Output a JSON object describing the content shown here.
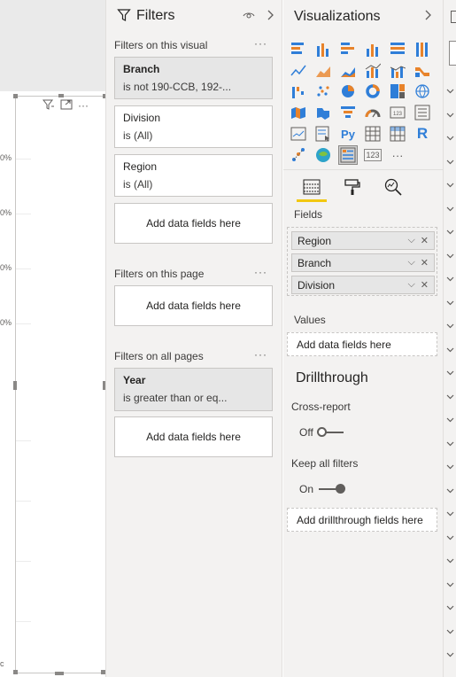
{
  "canvas": {
    "axis_labels": [
      "0%",
      "0%",
      "0%",
      "0%"
    ],
    "corner_label": "c"
  },
  "filters": {
    "title": "Filters",
    "sections": {
      "visual": "Filters on this visual",
      "page": "Filters on this page",
      "all": "Filters on all pages"
    },
    "more": "···",
    "visual_cards": [
      {
        "name": "Branch",
        "desc": "is not 190-CCB, 192-..."
      },
      {
        "name": "Division",
        "desc": "is (All)"
      },
      {
        "name": "Region",
        "desc": "is (All)"
      }
    ],
    "all_cards": [
      {
        "name": "Year",
        "desc": "is greater than or eq..."
      }
    ],
    "dropzone": "Add data fields here"
  },
  "viz": {
    "title": "Visualizations",
    "icons": [
      "stacked-bar-icon",
      "stacked-column-icon",
      "clustered-bar-icon",
      "clustered-column-icon",
      "100-stacked-bar-icon",
      "100-stacked-column-icon",
      "line-chart-icon",
      "area-chart-icon",
      "stacked-area-icon",
      "line-column-icon",
      "line-clustered-column-icon",
      "ribbon-chart-icon",
      "waterfall-icon",
      "scatter-icon",
      "pie-icon",
      "donut-icon",
      "treemap-icon",
      "map-icon",
      "filled-map-icon",
      "shape-map-icon",
      "funnel-icon",
      "gauge-icon",
      "card-icon",
      "multi-row-card-icon",
      "kpi-icon",
      "slicer-icon",
      "python-visual-icon",
      "table-icon",
      "matrix-icon",
      "r-visual-icon",
      "key-influencers-icon",
      "arcgis-map-icon",
      "custom-visual-icon",
      "number-card-icon",
      "more-visuals-icon"
    ],
    "selected_icon": "custom-visual-icon",
    "python_glyph": "Py",
    "r_glyph": "R",
    "number_glyph": "123",
    "more_glyph": "···",
    "fields_label": "Fields",
    "fields": [
      "Region",
      "Branch",
      "Division"
    ],
    "values_label": "Values",
    "values_dropzone": "Add data fields here",
    "drillthrough_title": "Drillthrough",
    "cross_report_label": "Cross-report",
    "cross_report_state": "Off",
    "keep_filters_label": "Keep all filters",
    "keep_filters_state": "On",
    "drillthrough_dropzone": "Add drillthrough fields here"
  },
  "colors": {
    "accent": "#f2c811",
    "pane_bg": "#f3f2f1",
    "selected_card": "#e6e6e6",
    "icon_blue": "#2f7ed8",
    "icon_orange": "#e8832a"
  }
}
